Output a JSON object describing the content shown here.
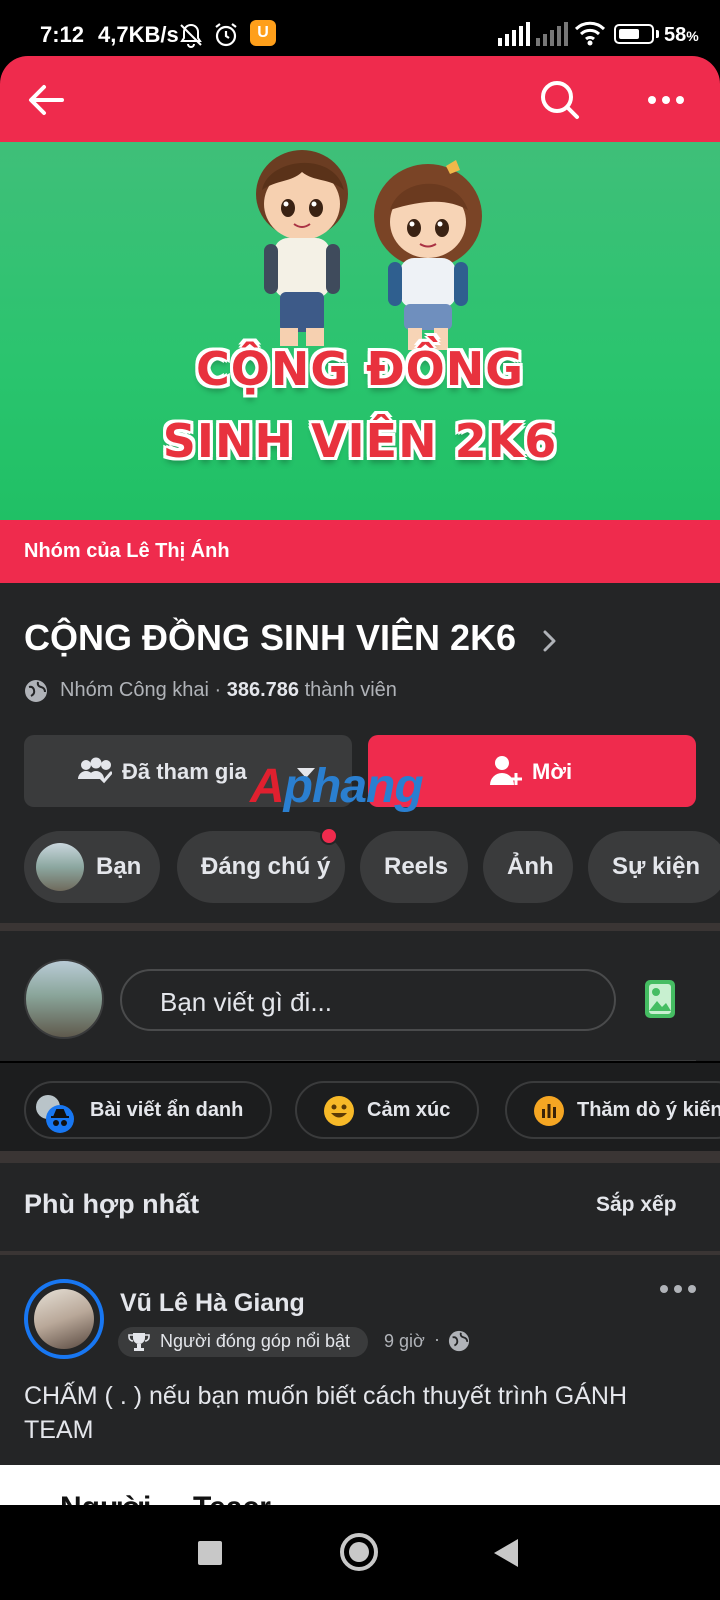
{
  "status_bar": {
    "time": "7:12",
    "network_speed": "4,7KB/s",
    "battery": "58",
    "battery_unit": "%"
  },
  "app_bar": {
    "back_icon": "arrow-left-icon",
    "search_icon": "search-icon",
    "more_icon": "more-horizontal-icon",
    "accent_color": "#ef2b4d"
  },
  "cover": {
    "line1": "CỘNG ĐỒNG",
    "line2": "SINH VIÊN 2K6",
    "background_color": "#2ac46e"
  },
  "owner_band": {
    "text": "Nhóm của Lê Thị Ánh"
  },
  "group": {
    "title": "CỘNG ĐỒNG SINH VIÊN 2K6",
    "privacy": "Nhóm Công khai · ",
    "member_count": "386.786",
    "member_suffix": " thành viên",
    "joined_label": "Đã tham gia",
    "invite_label": "Mời",
    "watermark_a": "A",
    "watermark_b": "phang",
    "watermark_c": "g"
  },
  "chips": [
    {
      "label": "Bạn"
    },
    {
      "label": "Đáng chú ý"
    },
    {
      "label": "Reels"
    },
    {
      "label": "Ảnh"
    },
    {
      "label": "Sự kiện"
    }
  ],
  "composer": {
    "placeholder": "Bạn viết gì đi...",
    "photo_icon": "photo-icon"
  },
  "quick_actions": [
    {
      "label": "Bài viết ẩn danh",
      "icon": "anonymous-icon"
    },
    {
      "label": "Cảm xúc",
      "icon": "smiley-icon"
    },
    {
      "label": "Thăm dò ý kiến",
      "icon": "poll-icon"
    }
  ],
  "sort": {
    "title": "Phù hợp nhất",
    "button": "Sắp xếp"
  },
  "post": {
    "author": "Vũ Lê Hà Giang",
    "badge": "Người đóng góp nổi bật",
    "time": "9 giờ",
    "separator": "·",
    "text": "CHẤM ( . ) nếu bạn muốn biết cách thuyết trình GÁNH TEAM"
  },
  "next_card": {
    "text": "Người ... Teacr ... ."
  }
}
